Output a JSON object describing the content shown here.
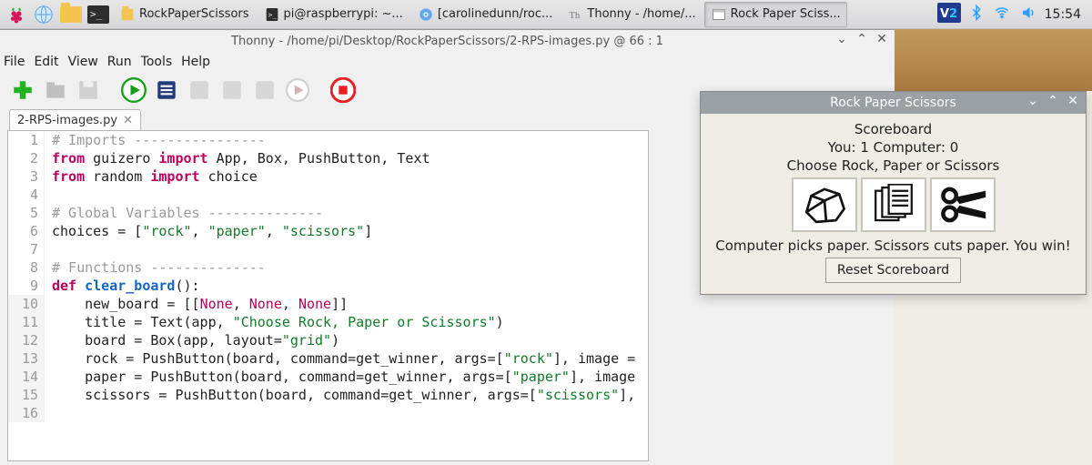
{
  "taskbar": {
    "items": [
      {
        "label": "RockPaperScissors"
      },
      {
        "label": "pi@raspberrypi: ~..."
      },
      {
        "label": "[carolinedunn/roc..."
      },
      {
        "label": "Thonny  -  /home/..."
      },
      {
        "label": "Rock Paper Sciss..."
      }
    ],
    "time": "15:54"
  },
  "thonny": {
    "title": "Thonny  -  /home/pi/Desktop/RockPaperScissors/2-RPS-images.py  @  66 : 1",
    "menu": [
      "File",
      "Edit",
      "View",
      "Run",
      "Tools",
      "Help"
    ],
    "tab": {
      "label": "2-RPS-images.py",
      "close": "✕"
    }
  },
  "code": {
    "l1": {
      "n": "1",
      "a": "# Imports ----------------"
    },
    "l2": {
      "n": "2",
      "a": "from",
      "b": " guizero ",
      "c": "import",
      "d": " App, Box, PushButton, Text"
    },
    "l3": {
      "n": "3",
      "a": "from",
      "b": " random ",
      "c": "import",
      "d": " choice"
    },
    "l4": {
      "n": "4"
    },
    "l5": {
      "n": "5",
      "a": "# Global Variables --------------"
    },
    "l6": {
      "n": "6",
      "a": "choices = [",
      "b": "\"rock\"",
      "c": ", ",
      "d": "\"paper\"",
      "e": ", ",
      "f": "\"scissors\"",
      "g": "]"
    },
    "l7": {
      "n": "7"
    },
    "l8": {
      "n": "8",
      "a": "# Functions --------------"
    },
    "l9": {
      "n": "9",
      "a": "def",
      "b": " ",
      "c": "clear_board",
      "d": "():"
    },
    "l10": {
      "n": "10",
      "a": "    new_board = [[",
      "b": "None",
      "c": ", ",
      "d": "None",
      "e": ", ",
      "f": "None",
      "g": "]]"
    },
    "l11": {
      "n": "11",
      "a": "    title = Text(app, ",
      "b": "\"Choose Rock, Paper or Scissors\"",
      "c": ")"
    },
    "l12": {
      "n": "12",
      "a": "    board = Box(app, layout=",
      "b": "\"grid\"",
      "c": ")"
    },
    "l13": {
      "n": "13",
      "a": "    rock = PushButton(board, command=get_winner, args=[",
      "b": "\"rock\"",
      "c": "], image ="
    },
    "l14": {
      "n": "14",
      "a": "    paper = PushButton(board, command=get_winner, args=[",
      "b": "\"paper\"",
      "c": "], image"
    },
    "l15": {
      "n": "15",
      "a": "    scissors = PushButton(board, command=get_winner, args=[",
      "b": "\"scissors\"",
      "c": "],"
    },
    "l16": {
      "n": "16"
    }
  },
  "rps": {
    "title": "Rock Paper Scissors",
    "scoreboard_label": "Scoreboard",
    "score_line": "You:  1 Computer:  0",
    "choose_label": "Choose Rock, Paper or Scissors",
    "result": "Computer picks paper. Scissors cuts paper. You win!",
    "reset_label": "Reset Scoreboard"
  }
}
